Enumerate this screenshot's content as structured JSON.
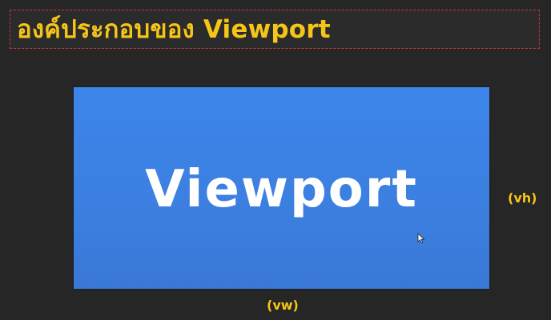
{
  "title": "องค์ประกอบของ Viewport",
  "viewport": {
    "label": "Viewport",
    "color": "#3d85ea"
  },
  "labels": {
    "height": "(vh)",
    "width": "(vw)"
  },
  "colors": {
    "accent": "#f5c518",
    "background": "#262626",
    "title_border": "#c73a3a"
  },
  "icons": {
    "cursor": "mouse-pointer-icon"
  }
}
